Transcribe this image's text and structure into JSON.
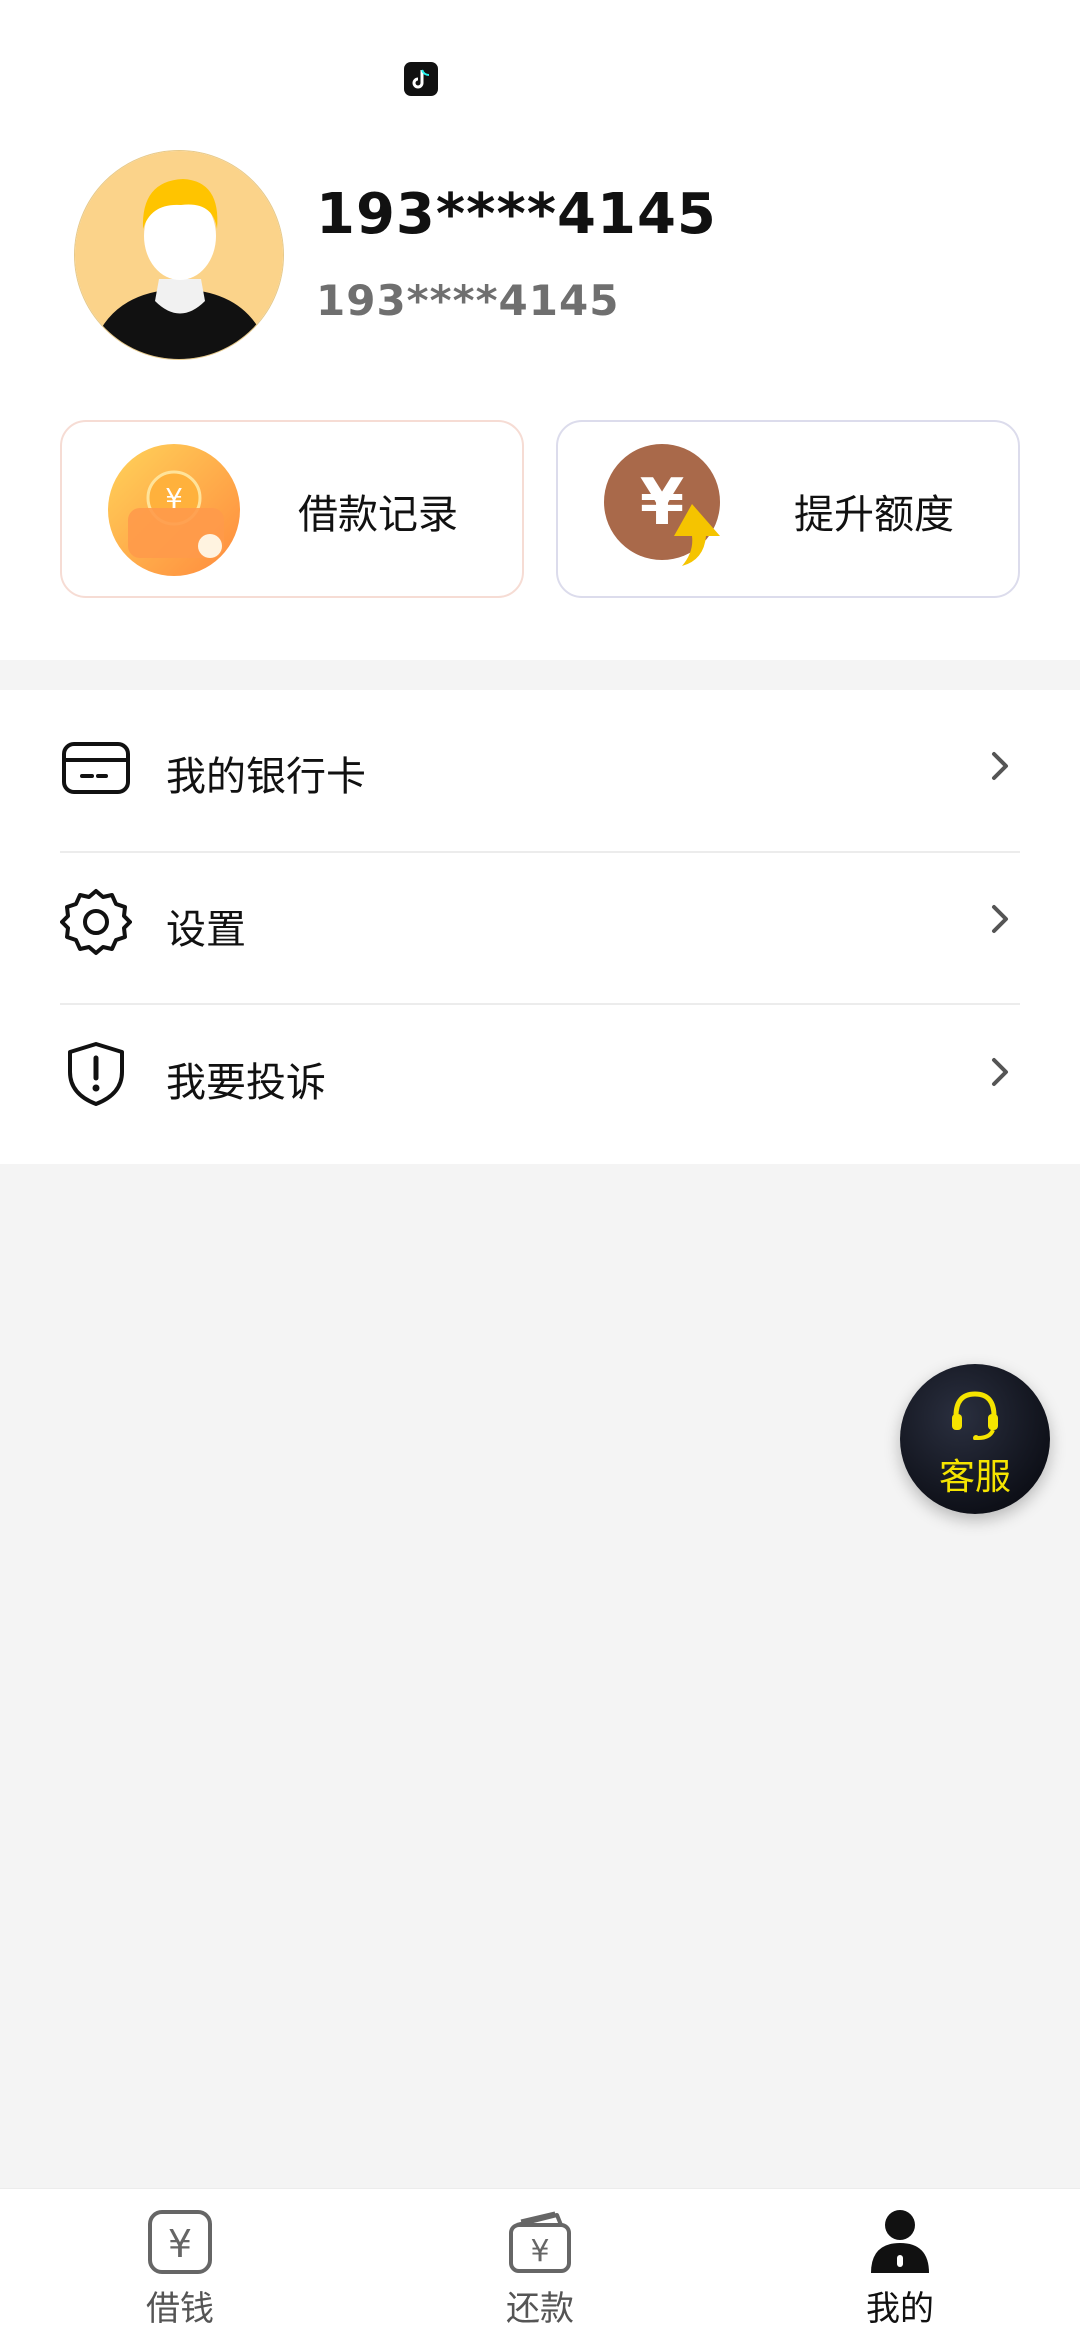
{
  "profile": {
    "title": "193****4145",
    "subtitle": "193****4145"
  },
  "cards": {
    "loan_records": "借款记录",
    "raise_limit": "提升额度"
  },
  "menu": {
    "items": [
      {
        "label": "我的银行卡",
        "icon": "bank-card-icon"
      },
      {
        "label": "设置",
        "icon": "gear-icon"
      },
      {
        "label": "我要投诉",
        "icon": "shield-alert-icon"
      }
    ]
  },
  "customer_service": {
    "label": "客服"
  },
  "tabbar": {
    "items": [
      {
        "label": "借钱",
        "icon": "yuan-box-icon"
      },
      {
        "label": "还款",
        "icon": "wallet-yuan-icon"
      },
      {
        "label": "我的",
        "icon": "person-icon",
        "active": true
      }
    ]
  },
  "colors": {
    "accent_yellow": "#f5e400",
    "card_left_border": "#f6dcd4",
    "card_right_border": "#dcdcec"
  }
}
